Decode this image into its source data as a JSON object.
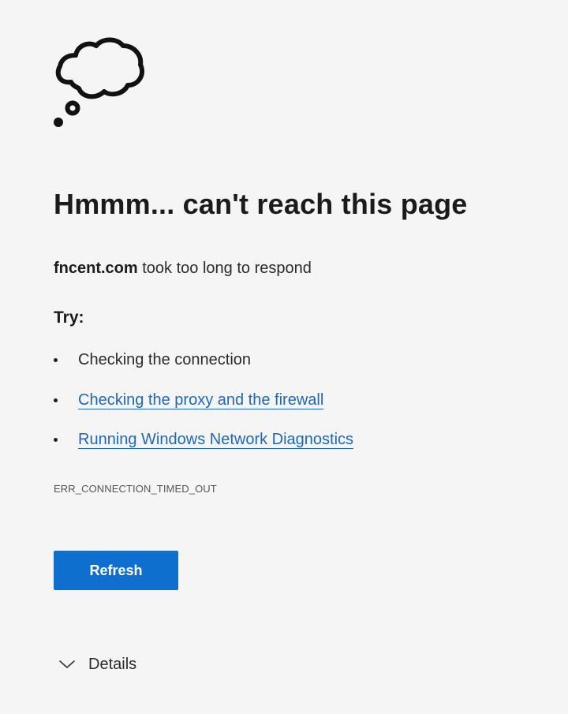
{
  "error_page": {
    "icon": "thought-cloud-icon",
    "heading": "Hmmm... can't reach this page",
    "domain": "fncent.com",
    "message": "took too long to respond",
    "try_label": "Try:",
    "suggestions": [
      {
        "label": "Checking the connection",
        "is_link": false
      },
      {
        "label": "Checking the proxy and the firewall",
        "is_link": true
      },
      {
        "label": "Running Windows Network Diagnostics",
        "is_link": true
      }
    ],
    "error_code": "ERR_CONNECTION_TIMED_OUT",
    "refresh_label": "Refresh",
    "details_label": "Details",
    "details_icon": "chevron-down-icon"
  },
  "colors": {
    "background": "#f5f5f5",
    "text": "#1b1b1b",
    "link": "#1e68b4",
    "button": "#0f6fcf",
    "button_text": "#ffffff"
  }
}
